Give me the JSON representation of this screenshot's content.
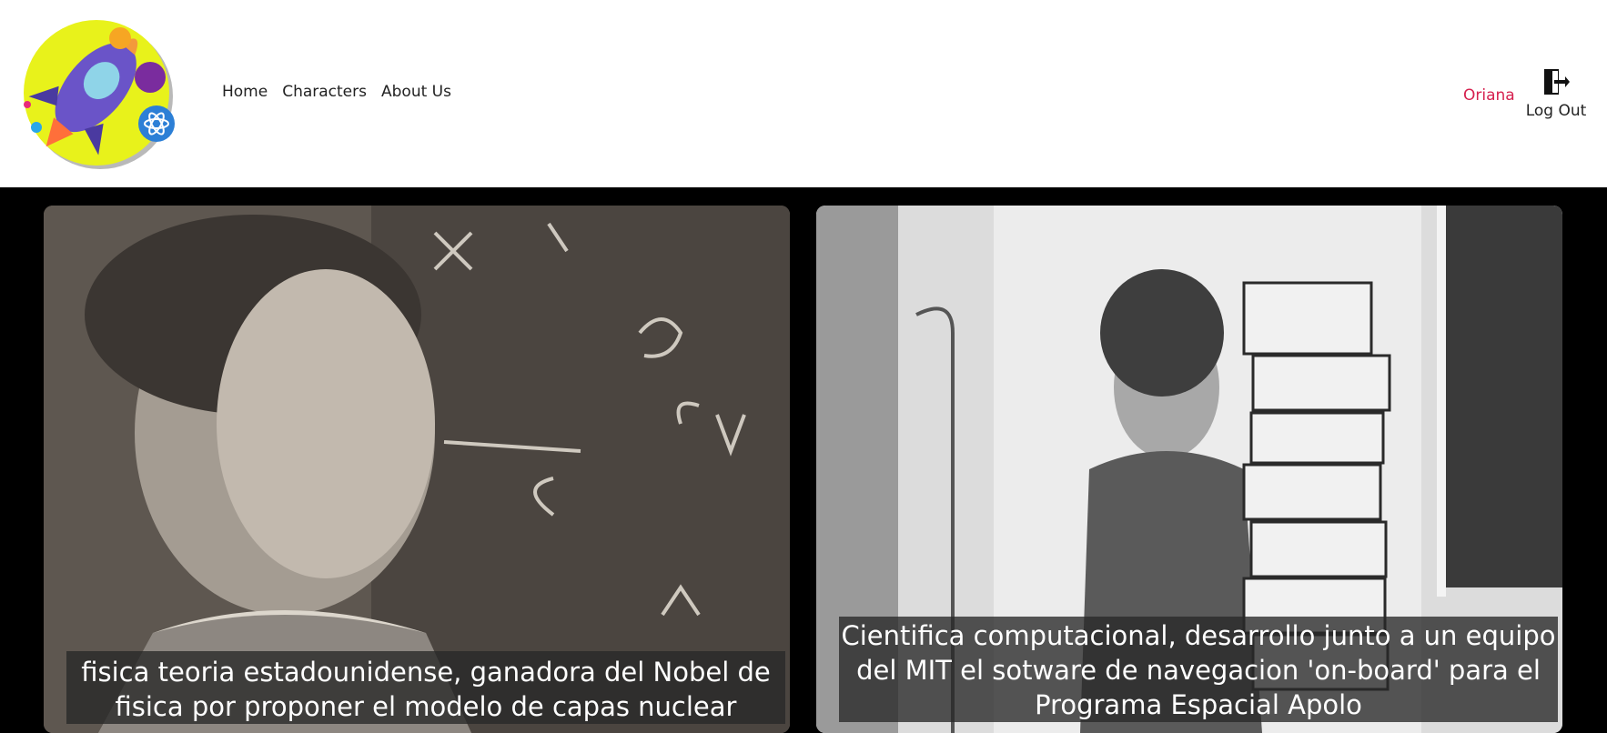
{
  "nav": {
    "items": [
      {
        "label": "Home"
      },
      {
        "label": "Characters"
      },
      {
        "label": "About Us"
      }
    ]
  },
  "user": {
    "name": "Oriana",
    "logout_label": "Log Out",
    "logout_icon": "logout-door-icon",
    "name_color": "#d6214f"
  },
  "logo": {
    "icon": "rocket-logo-icon",
    "bg_color": "#e8f21b"
  },
  "cards": [
    {
      "image": "scientist-chalkboard-photo",
      "caption": "fisica teoria estadounidense, ganadora del Nobel de fisica por proponer el modelo de capas nuclear"
    },
    {
      "image": "scientist-code-stack-photo",
      "caption": "Cientifica computacional, desarrollo junto a un equipo del MIT el sotware de navegacion 'on-board' para el Programa Espacial Apolo"
    }
  ]
}
